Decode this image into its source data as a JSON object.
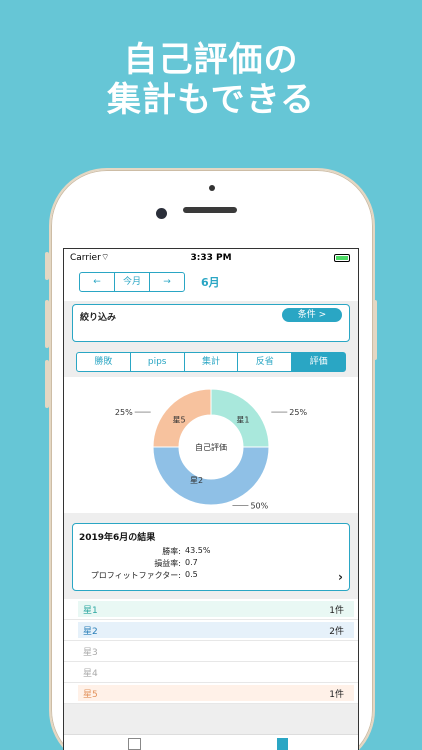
{
  "headline": {
    "line1": "自己評価の",
    "line2": "集計もできる"
  },
  "status_bar": {
    "carrier": "Carrier",
    "time": "3:33 PM"
  },
  "nav": {
    "prev": "←",
    "today": "今月",
    "next": "→",
    "month": "6月"
  },
  "filter": {
    "label": "絞り込み",
    "button": "条件 >"
  },
  "tabs": [
    "勝敗",
    "pips",
    "集計",
    "反省",
    "評価"
  ],
  "chart_data": {
    "type": "pie",
    "title": "自己評価",
    "categories": [
      "星1",
      "星2",
      "星5"
    ],
    "values": [
      25,
      50,
      25
    ],
    "colors": [
      "#a9e8dc",
      "#8fc0e6",
      "#f7c29e"
    ],
    "value_labels": [
      "25%",
      "50%",
      "25%"
    ]
  },
  "result": {
    "title": "2019年6月の結果",
    "rows": [
      {
        "label": "勝率:",
        "value": "43.5%"
      },
      {
        "label": "損益率:",
        "value": "0.7"
      },
      {
        "label": "プロフィットファクター:",
        "value": "0.5"
      }
    ],
    "chevron": "›"
  },
  "stars": [
    {
      "name": "星1",
      "count": "1件",
      "bar": "#e9f8f4",
      "text": "#2aa6a0"
    },
    {
      "name": "星2",
      "count": "2件",
      "bar": "#e6f1fa",
      "text": "#2a7fb8"
    },
    {
      "name": "星3",
      "count": "",
      "bar": "#ffffff",
      "text": "#aaaaaa"
    },
    {
      "name": "星4",
      "count": "",
      "bar": "#ffffff",
      "text": "#aaaaaa"
    },
    {
      "name": "星5",
      "count": "1件",
      "bar": "#fff1e8",
      "text": "#e2925c"
    }
  ]
}
